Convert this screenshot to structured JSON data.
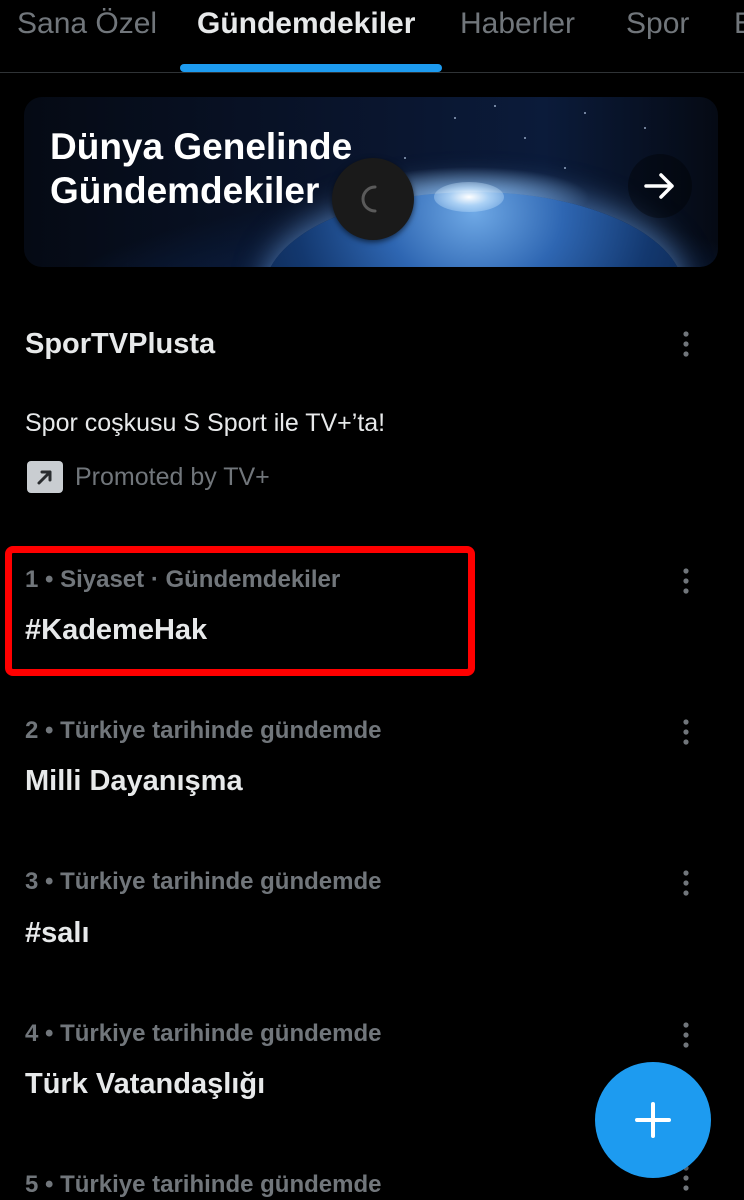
{
  "tabs": [
    {
      "label": "Sana Özel",
      "active": false
    },
    {
      "label": "Gündemdekiler",
      "active": true
    },
    {
      "label": "Haberler",
      "active": false
    },
    {
      "label": "Spor",
      "active": false
    },
    {
      "label": "E",
      "active": false
    }
  ],
  "banner": {
    "title": "Dünya Genelinde Gündemdekiler",
    "arrow_icon": "arrow-right-icon"
  },
  "loading_icon": "loading-spinner-icon",
  "promoted": {
    "title": "SporTVPlusta",
    "description": "Spor coşkusu S Sport ile TV+’ta!",
    "label": "Promoted by TV+",
    "icon": "promoted-arrow-icon"
  },
  "trends": [
    {
      "meta": "1 • Siyaset · Gündemdekiler",
      "name": "#KademeHak",
      "highlighted": true
    },
    {
      "meta": "2 • Türkiye tarihinde gündemde",
      "name": "Milli Dayanışma"
    },
    {
      "meta": "3 • Türkiye tarihinde gündemde",
      "name": "#salı"
    },
    {
      "meta": "4 • Türkiye tarihinde gündemde",
      "name": "Türk Vatandaşlığı"
    },
    {
      "meta": "5 • Türkiye tarihinde gündemde",
      "name": ""
    }
  ],
  "fab": {
    "icon": "plus-icon"
  },
  "colors": {
    "accent": "#1d9bf0",
    "background": "#000000",
    "text_primary": "#e7e9ea",
    "text_secondary": "#71767b",
    "highlight": "#ff0000"
  }
}
